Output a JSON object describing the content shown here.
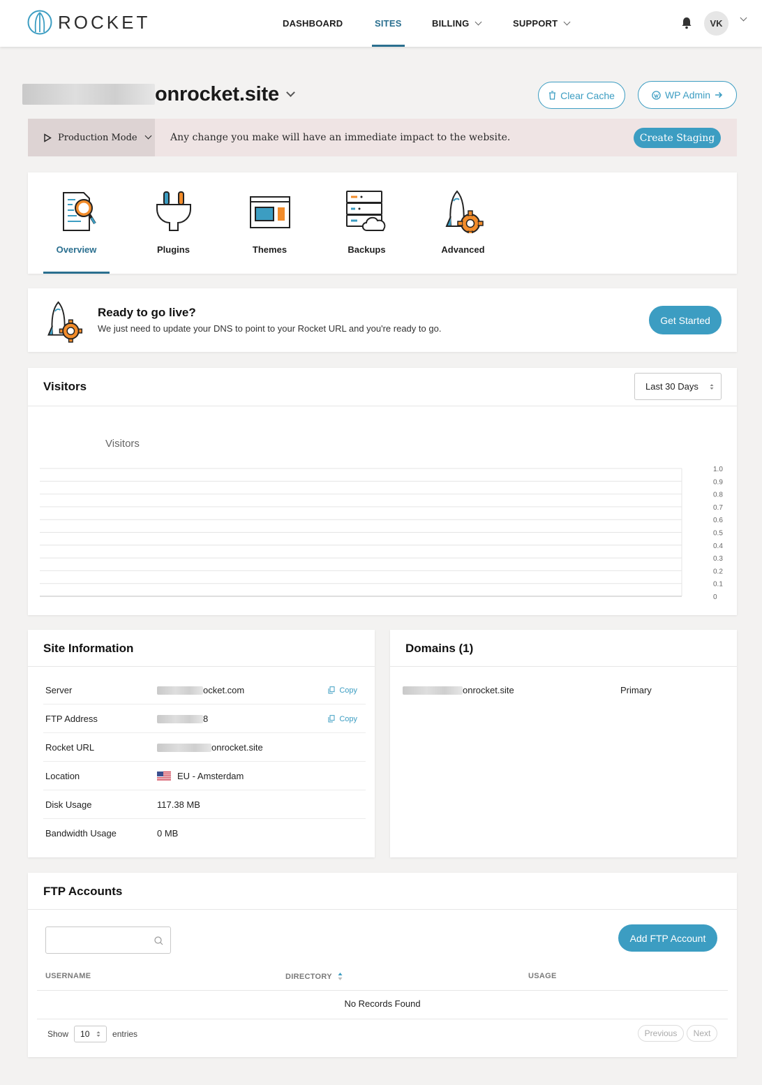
{
  "nav": {
    "brand": "ROCKET",
    "items": [
      {
        "label": "DASHBOARD",
        "active": false,
        "dropdown": false
      },
      {
        "label": "SITES",
        "active": true,
        "dropdown": false
      },
      {
        "label": "BILLING",
        "active": false,
        "dropdown": true
      },
      {
        "label": "SUPPORT",
        "active": false,
        "dropdown": true
      }
    ],
    "user_initials": "VK"
  },
  "site": {
    "title_visible": "onrocket.site",
    "clear_cache_label": "Clear Cache",
    "wp_admin_label": "WP Admin"
  },
  "mode_bar": {
    "mode_label": "Production Mode",
    "message": "Any change you make will have an immediate impact to the website.",
    "create_staging_label": "Create Staging"
  },
  "tabs": [
    {
      "label": "Overview",
      "icon": "overview-icon",
      "active": true
    },
    {
      "label": "Plugins",
      "icon": "plugin-icon",
      "active": false
    },
    {
      "label": "Themes",
      "icon": "themes-icon",
      "active": false
    },
    {
      "label": "Backups",
      "icon": "backups-icon",
      "active": false
    },
    {
      "label": "Advanced",
      "icon": "advanced-icon",
      "active": false
    }
  ],
  "golive": {
    "title": "Ready to go live?",
    "subtitle": "We just need to update your DNS to point to your Rocket URL and you're ready to go.",
    "button_label": "Get Started"
  },
  "visitors": {
    "title": "Visitors",
    "range_select": "Last 30 Days",
    "chart_legend": "Visitors"
  },
  "chart_data": {
    "type": "line",
    "title": "",
    "series": [
      {
        "name": "Visitors",
        "values": []
      }
    ],
    "y_ticks": [
      "1.0",
      "0.9",
      "0.8",
      "0.7",
      "0.6",
      "0.5",
      "0.4",
      "0.3",
      "0.2",
      "0.1",
      "0"
    ],
    "ylim": [
      0,
      1
    ],
    "grid": true
  },
  "site_info": {
    "title": "Site Information",
    "copy_label": "Copy",
    "rows": [
      {
        "label": "Server",
        "value": "ocket.com",
        "copy": true,
        "flag": false
      },
      {
        "label": "FTP Address",
        "value": "8",
        "copy": true,
        "flag": false
      },
      {
        "label": "Rocket URL",
        "value": "onrocket.site",
        "copy": false,
        "flag": false
      },
      {
        "label": "Location",
        "value": "EU - Amsterdam",
        "copy": false,
        "flag": true
      },
      {
        "label": "Disk Usage",
        "value": "117.38 MB",
        "copy": false,
        "flag": false
      },
      {
        "label": "Bandwidth Usage",
        "value": "0 MB",
        "copy": false,
        "flag": false
      }
    ]
  },
  "domains": {
    "title": "Domains (1)",
    "rows": [
      {
        "domain": "onrocket.site",
        "type": "Primary"
      }
    ]
  },
  "ftp": {
    "title": "FTP Accounts",
    "search_placeholder": "",
    "add_label": "Add FTP Account",
    "columns": [
      "USERNAME",
      "DIRECTORY",
      "USAGE"
    ],
    "empty_text": "No Records Found",
    "show_label": "Show",
    "page_size": "10",
    "entries_label": "entries",
    "prev_label": "Previous",
    "next_label": "Next"
  },
  "colors": {
    "accent": "#3c9dc2",
    "active_nav": "#2a6f8f",
    "orange": "#f28c2b",
    "mode_bar_bg": "#efe4e4"
  }
}
